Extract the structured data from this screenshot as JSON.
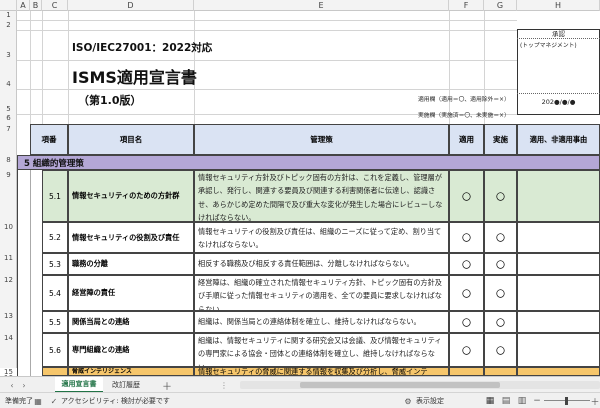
{
  "columns": [
    "A",
    "B",
    "C",
    "D",
    "E",
    "F",
    "G",
    "H"
  ],
  "row_numbers": [
    "1",
    "2",
    "3",
    "4",
    "5",
    "6",
    "7",
    "8",
    "9",
    "10",
    "11",
    "12",
    "13",
    "14",
    "15",
    "16"
  ],
  "doc": {
    "heading1": "ISO/IEC27001：2022対応",
    "heading2": "ISMS適用宣言書",
    "version": "（第1.0版）",
    "legend_applicable": "適用欄（適用＝〇、適用除外＝×）",
    "legend_implemented": "実施欄（実施済＝〇、未実施＝×）",
    "approval_label": "承認",
    "approval_role": "(トップマネジメント)",
    "approval_date": "202●/●/●"
  },
  "table": {
    "headers": [
      "項番",
      "項目名",
      "管理策",
      "適用",
      "実施",
      "適用、非適用事由"
    ],
    "section": "5 組織的管理策",
    "rows": [
      {
        "no": "5.1",
        "name": "情報セキュリティのための方針群",
        "desc": "情報セキュリティ方針及びトピック固有の方針は、これを定義し、管理層が承認し、発行し、関連する要員及び関連する利害関係者に伝達し、認識させ、あらかじめ定めた間隔で及び重大な変化が発生した場合にレビューしなければならない。",
        "applicable": "〇",
        "implemented": "〇"
      },
      {
        "no": "5.2",
        "name": "情報セキュリティの役割及び責任",
        "desc": "情報セキュリティの役割及び責任は、組織のニーズに従って定め、割り当てなければならない。",
        "applicable": "〇",
        "implemented": "〇"
      },
      {
        "no": "5.3",
        "name": "職務の分離",
        "desc": "相反する職務及び相反する責任範囲は、分離しなければならない。",
        "applicable": "〇",
        "implemented": "〇"
      },
      {
        "no": "5.4",
        "name": "経営陣の責任",
        "desc": "経営陣は、組織の確立された情報セキュリティ方針、トピック固有の方針及び手順に従った情報セキュリティの適用を、全ての要員に要求しなければならない。",
        "applicable": "〇",
        "implemented": "〇"
      },
      {
        "no": "5.5",
        "name": "関係当局との連絡",
        "desc": "組織は、関係当局との連絡体制を確立し、維持しなければならない。",
        "applicable": "〇",
        "implemented": "〇"
      },
      {
        "no": "5.6",
        "name": "専門組織との連絡",
        "desc": "組織は、情報セキュリティに関する研究会又は会議、及び情報セキュリティの専門家による協会・団体との連絡体制を確立し、維持しなければならない。",
        "applicable": "〇",
        "implemented": "〇"
      },
      {
        "no": "5.7",
        "name": "脅威インテリジェンス",
        "desc": "情報セキュリティの脅威に関連する情報を収集及び分析し、脅威インテ",
        "applicable": "",
        "implemented": ""
      }
    ]
  },
  "sheet_tabs": [
    "適用宣言書",
    "改訂履歴"
  ],
  "status": {
    "ready": "準備完了",
    "accessibility": "アクセシビリティ: 検討が必要です",
    "display_settings": "表示設定"
  },
  "colors": {
    "header_fill": "#dae3f3",
    "section_fill": "#b4a7d6",
    "highlight_row": "#d9ead3",
    "tab_active": "#ffffff",
    "accent": "#217346"
  }
}
